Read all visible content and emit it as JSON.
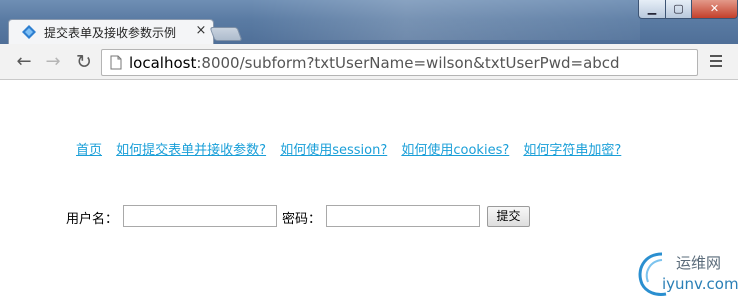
{
  "browser": {
    "tab_title": "提交表单及接收参数示例",
    "tab_close": "×",
    "url_host": "localhost",
    "url_rest": ":8000/subform?txtUserName=wilson&txtUserPwd=abcd"
  },
  "window_controls": {
    "minimize": "▁",
    "maximize": "▢",
    "close": "✕"
  },
  "nav": {
    "back": "←",
    "forward": "→",
    "reload": "↻"
  },
  "page": {
    "links": [
      "首页",
      "如何提交表单并接收参数?",
      "如何使用session?",
      "如何使用cookies?",
      "如何字符串加密?"
    ],
    "form": {
      "username_label": "用户名：",
      "username_value": "",
      "password_label": "密码：",
      "password_value": "",
      "submit_label": "提交"
    }
  },
  "watermark": {
    "cn": "运维网",
    "en": "iyunv.com"
  },
  "colors": {
    "link": "#1a9fd8",
    "titlebar": "#5a7ba3",
    "close_button": "#c4402b"
  },
  "icons": [
    "favicon-diamond-icon",
    "page-document-icon",
    "menu-hamburger-icon",
    "back-arrow-icon",
    "forward-arrow-icon",
    "reload-icon"
  ]
}
